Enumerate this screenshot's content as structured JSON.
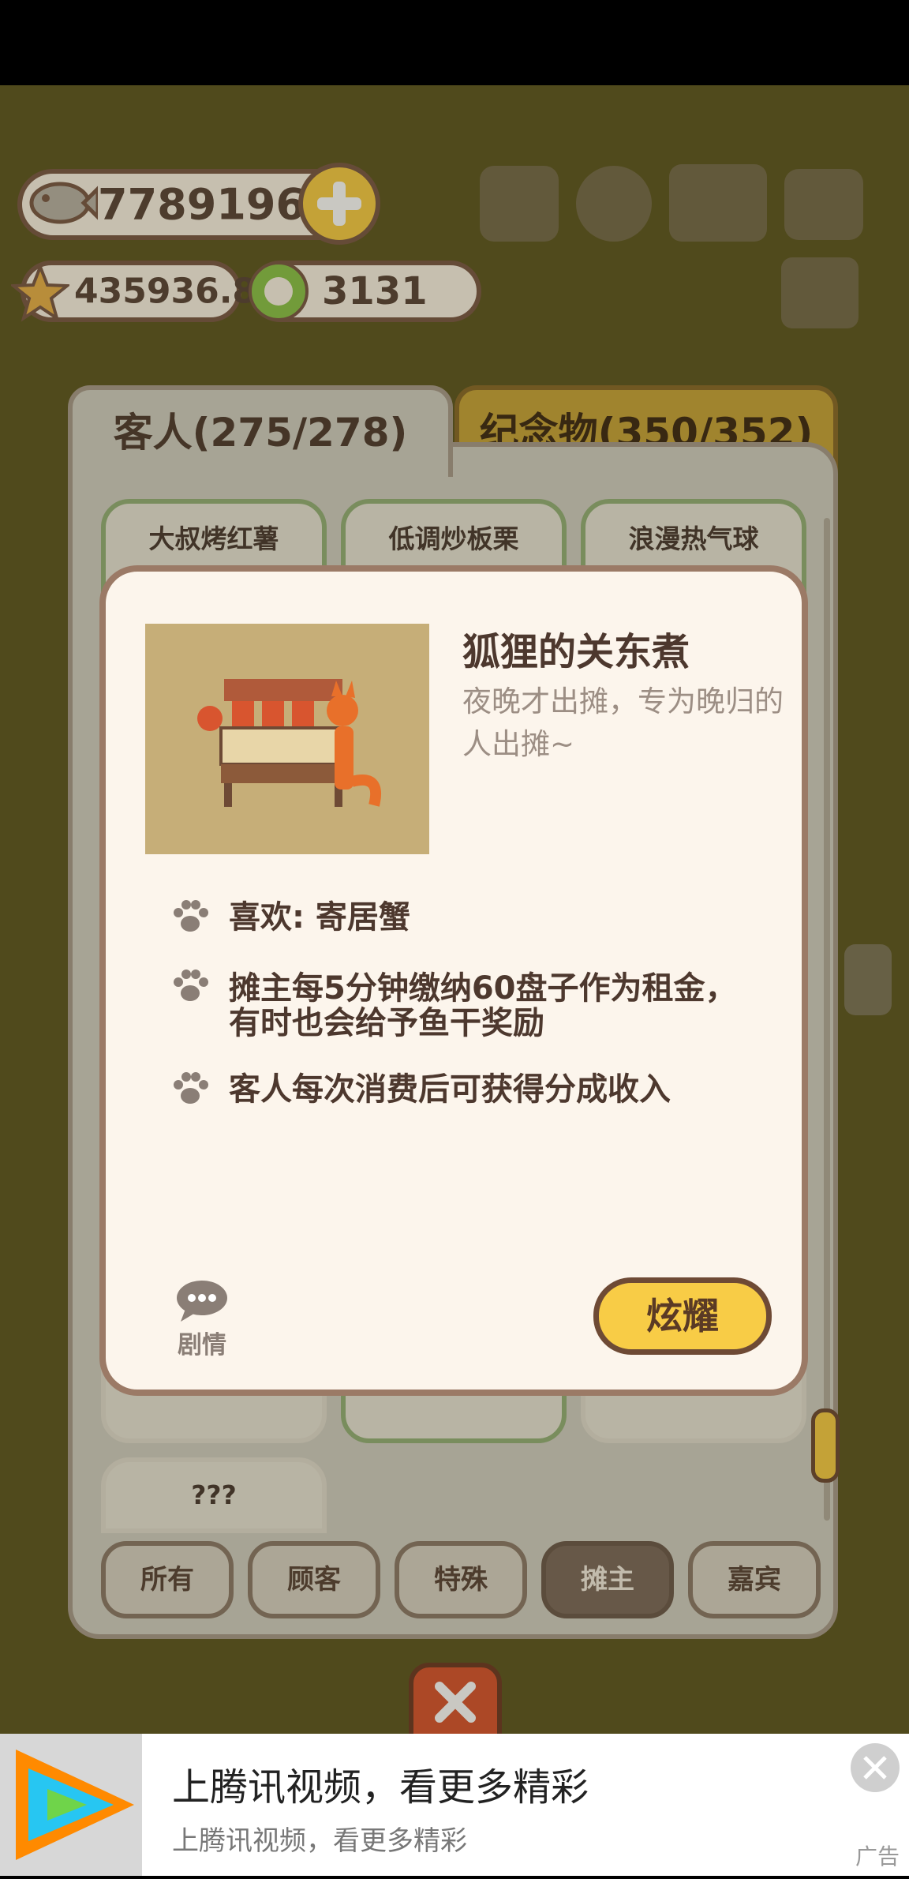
{
  "hud": {
    "fish_count": "77891969",
    "star_count": "435936.8",
    "coin_count": "3131"
  },
  "tabs": {
    "guests": "客人(275/278)",
    "souvenirs": "纪念物(350/352)"
  },
  "cards": [
    {
      "label": "大叔烤红薯"
    },
    {
      "label": "低调炒板栗"
    },
    {
      "label": "浪漫热气球"
    },
    {
      "label": "???"
    }
  ],
  "filters": [
    {
      "label": "所有",
      "active": false
    },
    {
      "label": "顾客",
      "active": false
    },
    {
      "label": "特殊",
      "active": false
    },
    {
      "label": "摊主",
      "active": true
    },
    {
      "label": "嘉宾",
      "active": false
    }
  ],
  "detail": {
    "title": "狐狸的关东煮",
    "description": "夜晚才出摊，专为晚归的人出摊~",
    "traits": [
      "喜欢: 寄居蟹",
      "摊主每5分钟缴纳60盘子作为租金，有时也会给予鱼干奖励",
      "客人每次消费后可获得分成收入"
    ],
    "story_label": "剧情",
    "show_button": "炫耀"
  },
  "ad": {
    "title": "上腾讯视频，看更多精彩",
    "subtitle": "上腾讯视频，看更多精彩",
    "tag": "广告"
  },
  "colors": {
    "accent_yellow": "#f8cc46",
    "panel_border": "#9b7a66",
    "active_filter": "#7d6a5c"
  }
}
